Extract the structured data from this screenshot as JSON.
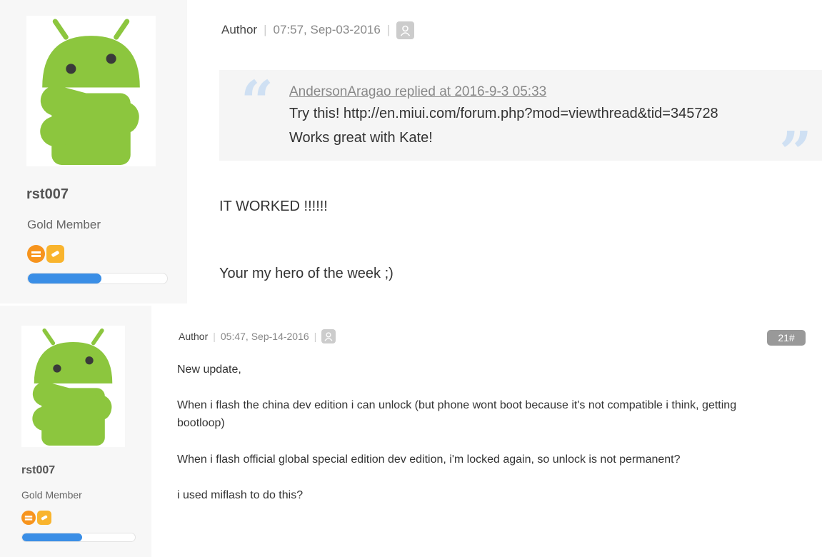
{
  "posts": [
    {
      "username": "rst007",
      "rank": "Gold Member",
      "author_label": "Author",
      "timestamp": "07:57, Sep-03-2016",
      "quote": {
        "header": "AndersonAragao replied at 2016-9-3 05:33",
        "lines": [
          "Try this! http://en.miui.com/forum.php?mod=viewthread&tid=345728",
          "Works great with Kate!"
        ]
      },
      "body": [
        "IT WORKED !!!!!!",
        "Your my hero of the week ;)"
      ],
      "level_progress": 0.53
    },
    {
      "username": "rst007",
      "rank": "Gold Member",
      "author_label": "Author",
      "timestamp": "05:47, Sep-14-2016",
      "floor": "21#",
      "body": [
        "New update,",
        "When i flash the china dev edition i can unlock (but phone wont boot because it's not compatible i think, getting",
        "bootloop)",
        "When i flash official global special edition dev edition, i'm locked again, so unlock is not permanent?",
        "i used miflash to do this?"
      ],
      "level_progress": 0.53
    }
  ],
  "colors": {
    "android_green": "#8cc63e",
    "progress_blue": "#3a8ee6",
    "medal_orange": "#f7941d"
  },
  "icons": [
    "android-avatar",
    "medal-orange-icon",
    "medal-yellow-icon",
    "user-icon",
    "open-quote-icon",
    "close-quote-icon"
  ]
}
